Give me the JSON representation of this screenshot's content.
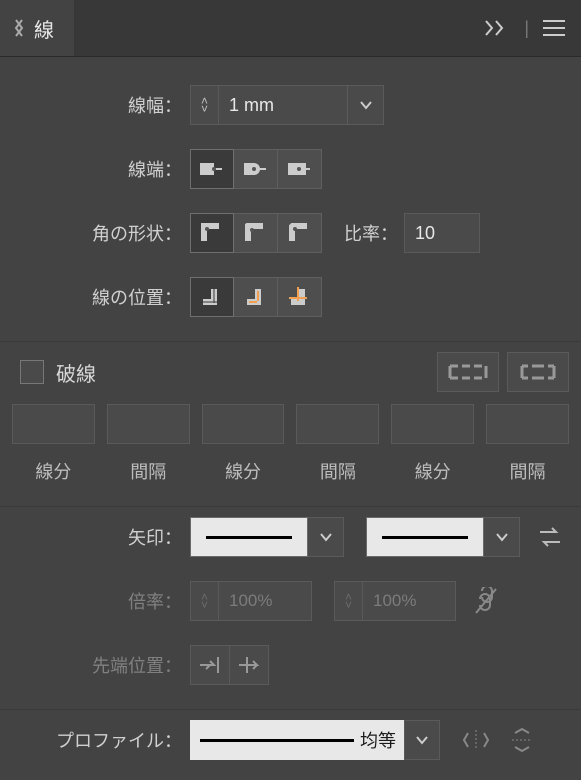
{
  "panel": {
    "tab_label": "線"
  },
  "stroke": {
    "width_label": "線幅：",
    "width_value": "1 mm",
    "cap_label": "線端：",
    "join_label": "角の形状：",
    "ratio_label": "比率：",
    "ratio_value": "10",
    "align_label": "線の位置："
  },
  "dash": {
    "title": "破線",
    "labels": [
      "線分",
      "間隔",
      "線分",
      "間隔",
      "線分",
      "間隔"
    ]
  },
  "arrows": {
    "label": "矢印：",
    "scale_label": "倍率：",
    "scale_start": "100%",
    "scale_end": "100%",
    "tip_label": "先端位置："
  },
  "profile": {
    "label": "プロファイル：",
    "name": "均等"
  }
}
